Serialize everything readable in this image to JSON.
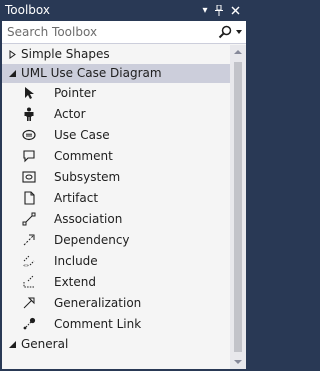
{
  "window": {
    "title": "Toolbox",
    "dropdown_icon": "chevron-down-icon",
    "pin_icon": "pin-icon",
    "close_icon": "close-icon"
  },
  "search": {
    "placeholder": "Search Toolbox",
    "icon": "search-icon"
  },
  "categories": [
    {
      "label": "Simple Shapes",
      "expanded": false
    },
    {
      "label": "UML Use Case Diagram",
      "expanded": true
    },
    {
      "label": "General",
      "expanded": true
    }
  ],
  "items": [
    {
      "label": "Pointer",
      "icon": "pointer-icon"
    },
    {
      "label": "Actor",
      "icon": "actor-icon"
    },
    {
      "label": "Use Case",
      "icon": "use-case-icon"
    },
    {
      "label": "Comment",
      "icon": "comment-icon"
    },
    {
      "label": "Subsystem",
      "icon": "subsystem-icon"
    },
    {
      "label": "Artifact",
      "icon": "artifact-icon"
    },
    {
      "label": "Association",
      "icon": "association-icon"
    },
    {
      "label": "Dependency",
      "icon": "dependency-icon"
    },
    {
      "label": "Include",
      "icon": "include-icon"
    },
    {
      "label": "Extend",
      "icon": "extend-icon"
    },
    {
      "label": "Generalization",
      "icon": "generalization-icon"
    },
    {
      "label": "Comment Link",
      "icon": "comment-link-icon"
    }
  ],
  "colors": {
    "chrome": "#293955",
    "panel": "#f5f5f5",
    "selected_category": "#cccedb",
    "scrollbar_track": "#e8e8ec",
    "scrollbar_thumb": "#c2c3c9"
  }
}
